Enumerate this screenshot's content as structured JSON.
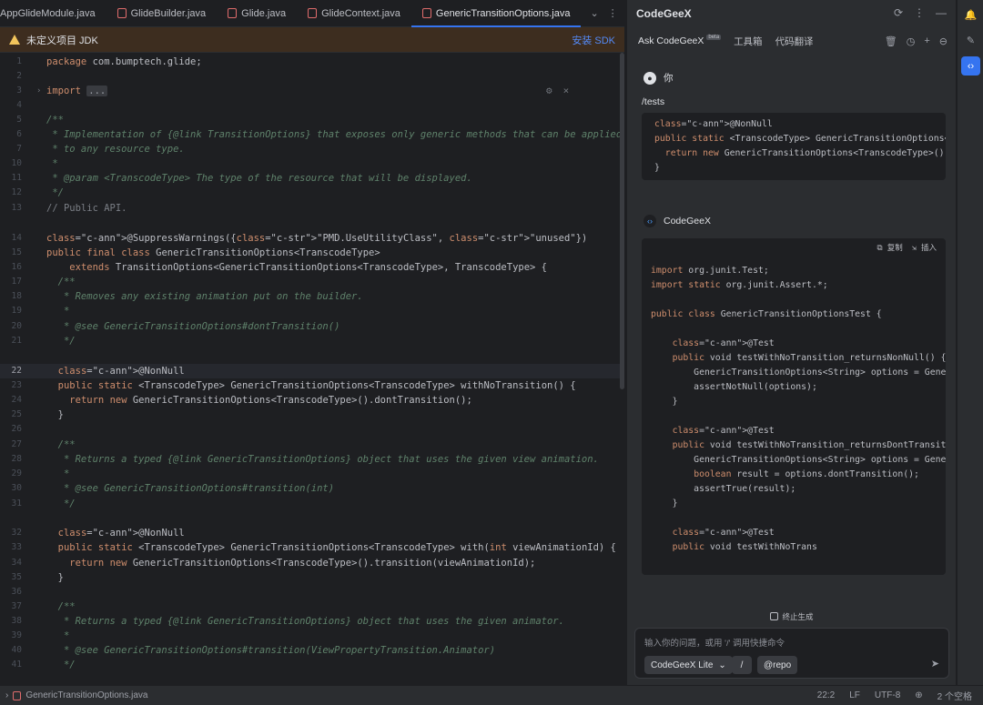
{
  "editor_tabs": [
    {
      "label": "AppGlideModule.java",
      "active": false
    },
    {
      "label": "GlideBuilder.java",
      "active": false
    },
    {
      "label": "Glide.java",
      "active": false
    },
    {
      "label": "GlideContext.java",
      "active": false
    },
    {
      "label": "GenericTransitionOptions.java",
      "active": true
    }
  ],
  "banner": {
    "text": "未定义项目 JDK",
    "action": "安装 SDK"
  },
  "code_lines": [
    {
      "n": "1",
      "code": "package com.bumptech.glide;"
    },
    {
      "n": "2",
      "code": ""
    },
    {
      "n": "3",
      "code": "import ..."
    },
    {
      "n": "4",
      "code": ""
    },
    {
      "n": "5",
      "code": "/**"
    },
    {
      "n": "6",
      "code": " * Implementation of {@link TransitionOptions} that exposes only generic methods that can be applied"
    },
    {
      "n": "7",
      "code": " * to any resource type."
    },
    {
      "n": "10",
      "code": " *"
    },
    {
      "n": "11",
      "code": " * @param <TranscodeType> The type of the resource that will be displayed."
    },
    {
      "n": "12",
      "code": " */"
    },
    {
      "n": "13",
      "code": "// Public API."
    },
    {
      "n": "",
      "code": ""
    },
    {
      "n": "14",
      "code": "@SuppressWarnings({\"PMD.UseUtilityClass\", \"unused\"})"
    },
    {
      "n": "15",
      "code": "public final class GenericTransitionOptions<TranscodeType>"
    },
    {
      "n": "16",
      "code": "    extends TransitionOptions<GenericTransitionOptions<TranscodeType>, TranscodeType> {"
    },
    {
      "n": "17",
      "code": "  /**"
    },
    {
      "n": "18",
      "code": "   * Removes any existing animation put on the builder."
    },
    {
      "n": "19",
      "code": "   *"
    },
    {
      "n": "20",
      "code": "   * @see GenericTransitionOptions#dontTransition()"
    },
    {
      "n": "21",
      "code": "   */"
    },
    {
      "n": "",
      "code": ""
    },
    {
      "n": "22",
      "code": "  @NonNull"
    },
    {
      "n": "23",
      "code": "  public static <TranscodeType> GenericTransitionOptions<TranscodeType> withNoTransition() {"
    },
    {
      "n": "24",
      "code": "    return new GenericTransitionOptions<TranscodeType>().dontTransition();"
    },
    {
      "n": "25",
      "code": "  }"
    },
    {
      "n": "26",
      "code": ""
    },
    {
      "n": "27",
      "code": "  /**"
    },
    {
      "n": "28",
      "code": "   * Returns a typed {@link GenericTransitionOptions} object that uses the given view animation."
    },
    {
      "n": "29",
      "code": "   *"
    },
    {
      "n": "30",
      "code": "   * @see GenericTransitionOptions#transition(int)"
    },
    {
      "n": "31",
      "code": "   */"
    },
    {
      "n": "",
      "code": ""
    },
    {
      "n": "32",
      "code": "  @NonNull"
    },
    {
      "n": "33",
      "code": "  public static <TranscodeType> GenericTransitionOptions<TranscodeType> with(int viewAnimationId) {"
    },
    {
      "n": "34",
      "code": "    return new GenericTransitionOptions<TranscodeType>().transition(viewAnimationId);"
    },
    {
      "n": "35",
      "code": "  }"
    },
    {
      "n": "36",
      "code": ""
    },
    {
      "n": "37",
      "code": "  /**"
    },
    {
      "n": "38",
      "code": "   * Returns a typed {@link GenericTransitionOptions} object that uses the given animator."
    },
    {
      "n": "39",
      "code": "   *"
    },
    {
      "n": "40",
      "code": "   * @see GenericTransitionOptions#transition(ViewPropertyTransition.Animator)"
    },
    {
      "n": "41",
      "code": "   */"
    }
  ],
  "current_line": "22",
  "panel": {
    "title": "CodeGeeX",
    "tabs": [
      {
        "label": "Ask CodeGeeX",
        "badge": "beta",
        "active": true
      },
      {
        "label": "工具箱",
        "active": false
      },
      {
        "label": "代码翻译",
        "active": false
      }
    ],
    "user_name": "你",
    "user_command": "/tests",
    "user_code": [
      "@NonNull",
      "public static <TranscodeType> GenericTransitionOptions<",
      "  return new GenericTransitionOptions<TranscodeType>()",
      "}"
    ],
    "bot_name": "CodeGeeX",
    "copy_label": "复制",
    "insert_label": "插入",
    "bot_code": [
      "import org.junit.Test;",
      "import static org.junit.Assert.*;",
      "",
      "public class GenericTransitionOptionsTest {",
      "",
      "    @Test",
      "    public void testWithNoTransition_returnsNonNull() {",
      "        GenericTransitionOptions<String> options = Generi",
      "        assertNotNull(options);",
      "    }",
      "",
      "    @Test",
      "    public void testWithNoTransition_returnsDontTransitio",
      "        GenericTransitionOptions<String> options = Generi",
      "        boolean result = options.dontTransition();",
      "        assertTrue(result);",
      "    }",
      "",
      "    @Test",
      "    public void testWithNoTrans"
    ],
    "stop_label": "终止生成",
    "input_placeholder": "输入你的问题，或用 '/' 调用快捷命令",
    "model_label": "CodeGeeX Lite",
    "slash_label": "/",
    "repo_label": "@repo"
  },
  "statusbar": {
    "file": "GenericTransitionOptions.java",
    "position": "22:2",
    "line_sep": "LF",
    "encoding": "UTF-8",
    "indent": "2 个空格"
  }
}
